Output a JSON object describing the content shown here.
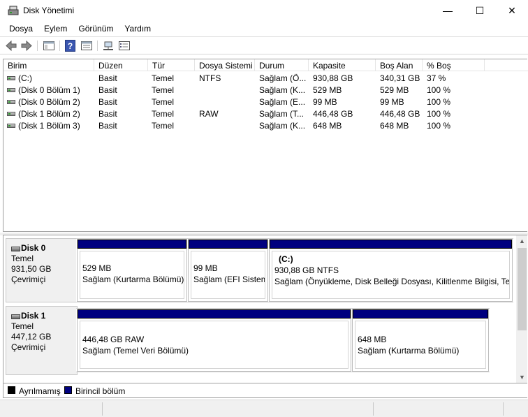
{
  "window": {
    "title": "Disk Yönetimi",
    "minimize_glyph": "—",
    "maximize_glyph": "☐",
    "close_glyph": "✕"
  },
  "menu": [
    "Dosya",
    "Eylem",
    "Görünüm",
    "Yardım"
  ],
  "toolbar_icons": [
    "back-icon",
    "forward-icon",
    "console-tree-icon",
    "help-icon",
    "properties-icon",
    "connect-icon",
    "list-view-icon"
  ],
  "list": {
    "columns": [
      "Birim",
      "Düzen",
      "Tür",
      "Dosya Sistemi",
      "Durum",
      "Kapasite",
      "Boş Alan",
      "% Boş"
    ],
    "rows": [
      [
        "(C:)",
        "Basit",
        "Temel",
        "NTFS",
        "Sağlam (Ö...",
        "930,88 GB",
        "340,31 GB",
        "37 %"
      ],
      [
        "(Disk 0 Bölüm 1)",
        "Basit",
        "Temel",
        "",
        "Sağlam (K...",
        "529 MB",
        "529 MB",
        "100 %"
      ],
      [
        "(Disk 0 Bölüm 2)",
        "Basit",
        "Temel",
        "",
        "Sağlam (E...",
        "99 MB",
        "99 MB",
        "100 %"
      ],
      [
        "(Disk 1 Bölüm 2)",
        "Basit",
        "Temel",
        "RAW",
        "Sağlam (T...",
        "446,48 GB",
        "446,48 GB",
        "100 %"
      ],
      [
        "(Disk 1 Bölüm 3)",
        "Basit",
        "Temel",
        "",
        "Sağlam (K...",
        "648 MB",
        "648 MB",
        "100 %"
      ]
    ]
  },
  "disks": [
    {
      "name": "Disk 0",
      "type": "Temel",
      "size": "931,50 GB",
      "status": "Çevrimiçi",
      "partitions": [
        {
          "title": "",
          "size": "529 MB",
          "status": "Sağlam (Kurtarma Bölümü)"
        },
        {
          "title": "",
          "size": "99 MB",
          "status": "Sağlam (EFI Sistem"
        },
        {
          "title": "(C:)",
          "size": "930,88 GB NTFS",
          "status": "Sağlam (Önyükleme, Disk Belleği Dosyası, Kilitlenme Bilgisi, Temel"
        }
      ]
    },
    {
      "name": "Disk 1",
      "type": "Temel",
      "size": "447,12 GB",
      "status": "Çevrimiçi",
      "partitions": [
        {
          "title": "",
          "size": "446,48 GB RAW",
          "status": "Sağlam (Temel Veri Bölümü)"
        },
        {
          "title": "",
          "size": "648 MB",
          "status": "Sağlam (Kurtarma Bölümü)"
        }
      ]
    }
  ],
  "scrollbar": {
    "up_glyph": "▲",
    "down_glyph": "▼"
  },
  "legend": [
    {
      "label": "Ayrılmamış",
      "color": "#000000"
    },
    {
      "label": "Birincil bölüm",
      "color": "#00007f"
    }
  ]
}
